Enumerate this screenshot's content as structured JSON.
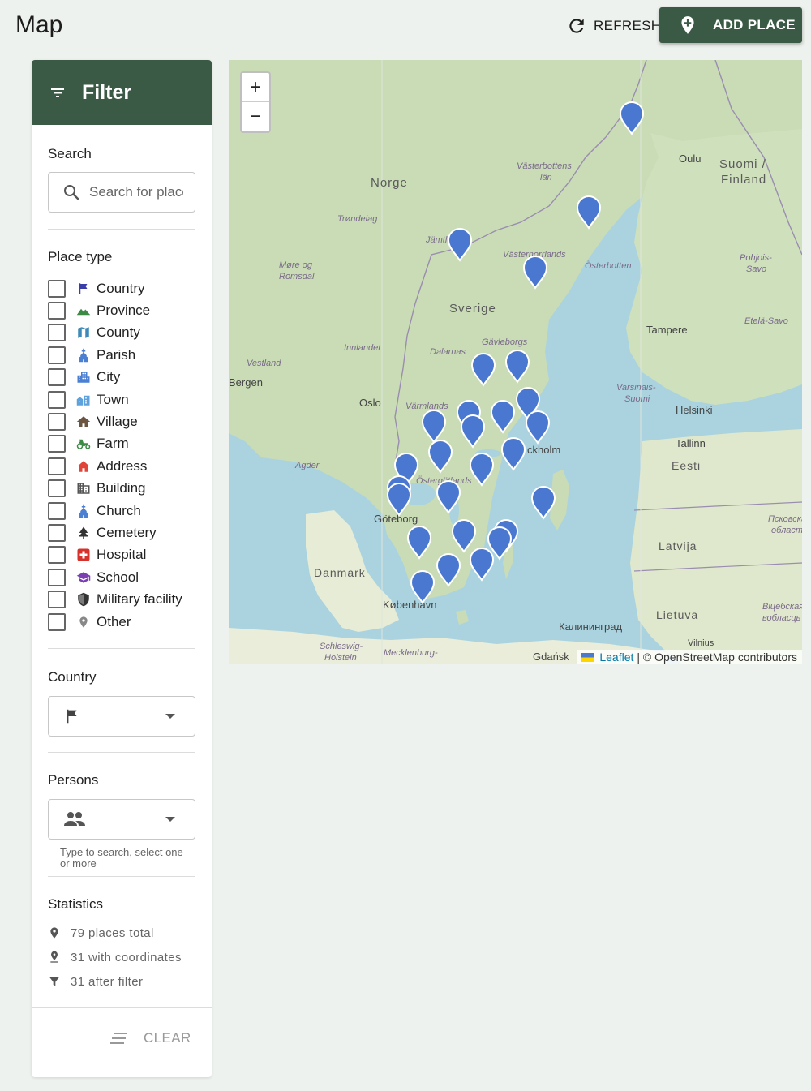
{
  "header": {
    "title": "Map",
    "refresh_label": "REFRESH",
    "add_place_label": "ADD PLACE"
  },
  "filter": {
    "title": "Filter",
    "search": {
      "label": "Search",
      "placeholder": "Search for places..."
    },
    "place_type": {
      "label": "Place type",
      "items": [
        {
          "label": "Country",
          "icon": "flag-icon",
          "color": "#3a3ea8"
        },
        {
          "label": "Province",
          "icon": "terrain-icon",
          "color": "#3d8a45"
        },
        {
          "label": "County",
          "icon": "map-icon",
          "color": "#3c8ab8"
        },
        {
          "label": "Parish",
          "icon": "church-icon",
          "color": "#4a7fd1"
        },
        {
          "label": "City",
          "icon": "city-icon",
          "color": "#4a7fd1"
        },
        {
          "label": "Town",
          "icon": "town-icon",
          "color": "#5ea2dd"
        },
        {
          "label": "Village",
          "icon": "house-icon",
          "color": "#6b5440"
        },
        {
          "label": "Farm",
          "icon": "tractor-icon",
          "color": "#3d8a45"
        },
        {
          "label": "Address",
          "icon": "home-icon",
          "color": "#e0453a"
        },
        {
          "label": "Building",
          "icon": "building-icon",
          "color": "#555555"
        },
        {
          "label": "Church",
          "icon": "church-icon",
          "color": "#4a7fd1"
        },
        {
          "label": "Cemetery",
          "icon": "tree-icon",
          "color": "#333333"
        },
        {
          "label": "Hospital",
          "icon": "hospital-icon",
          "color": "#d6322b"
        },
        {
          "label": "School",
          "icon": "school-icon",
          "color": "#7b3fb3"
        },
        {
          "label": "Military facility",
          "icon": "shield-icon",
          "color": "#333333"
        },
        {
          "label": "Other",
          "icon": "pin-icon",
          "color": "#888888"
        }
      ]
    },
    "country": {
      "label": "Country",
      "icon": "flag-icon"
    },
    "persons": {
      "label": "Persons",
      "icon": "people-icon",
      "helper": "Type to search, select one or more"
    },
    "statistics": {
      "label": "Statistics",
      "items": [
        {
          "text": "79 places total",
          "icon": "place-icon"
        },
        {
          "text": "31 with coordinates",
          "icon": "pin-drop-icon"
        },
        {
          "text": "31 after filter",
          "icon": "filter-icon"
        }
      ]
    },
    "clear_label": "CLEAR"
  },
  "map": {
    "zoom_in": "+",
    "zoom_out": "−",
    "attribution_link": "Leaflet",
    "attribution_text": "| © OpenStreetMap contributors",
    "marker_color": "#4a78d0",
    "labels": [
      "Norge",
      "Sverige",
      "Suomi /",
      "Finland",
      "Oulu",
      "Tampere",
      "Helsinki",
      "Tallinn",
      "Eesti",
      "Latvija",
      "Lietuva",
      "Danmark",
      "København",
      "Göteborg",
      "Oslo",
      "Bergen",
      "ckholm",
      "Gdańsk",
      "Калининград",
      "Vilnius",
      "Trøndelag",
      "Møre og",
      "Romsdal",
      "Innlandet",
      "Vestland",
      "Agder",
      "Västerbottens",
      "län",
      "Västernorrlands",
      "Österbotten",
      "Gävleborgs",
      "Dalarnas",
      "Värmlands",
      "Östergötlands",
      "Jämtl",
      "Pohjois-",
      "Savo",
      "Etelä-Savo",
      "Varsinais-",
      "Suomi",
      "Schleswig-",
      "Holstein",
      "Mecklenburg-",
      "Псковская",
      "область",
      "Віцебская",
      "вобласць"
    ]
  }
}
